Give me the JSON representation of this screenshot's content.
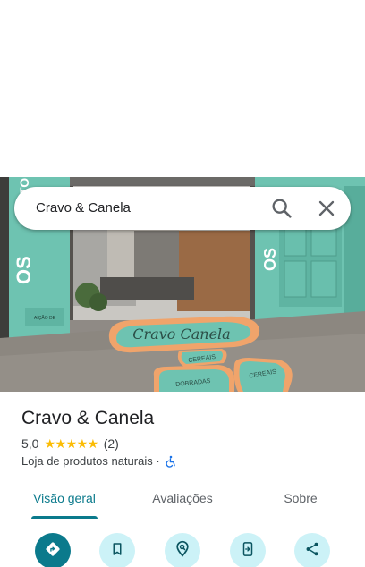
{
  "search": {
    "query": "Cravo & Canela"
  },
  "place": {
    "name": "Cravo & Canela",
    "rating": "5,0",
    "stars": "★★★★★",
    "review_count": "(2)",
    "category": "Loja de produtos naturais ·"
  },
  "photo": {
    "floor_sign_text": "Cravo Canela",
    "floor_tile_1": "CEREAIS",
    "floor_tile_2": "DOBRADAS",
    "floor_tile_3": "CEREAIS",
    "side_text": "OS",
    "side_text_right": "OS",
    "top_text": "TO",
    "wall_sticker_text": "AÍÇÃO DE"
  },
  "tabs": [
    {
      "label": "Visão geral",
      "active": true
    },
    {
      "label": "Avaliações",
      "active": false
    },
    {
      "label": "Sobre",
      "active": false
    }
  ],
  "actions": [
    "directions-icon",
    "save-icon",
    "nearby-icon",
    "send-to-phone-icon",
    "share-icon"
  ],
  "colors": {
    "accent": "#0b7a8c",
    "action_bg": "#ccf2f7",
    "star": "#fbbc04",
    "store_teal": "#6ec3b1"
  }
}
